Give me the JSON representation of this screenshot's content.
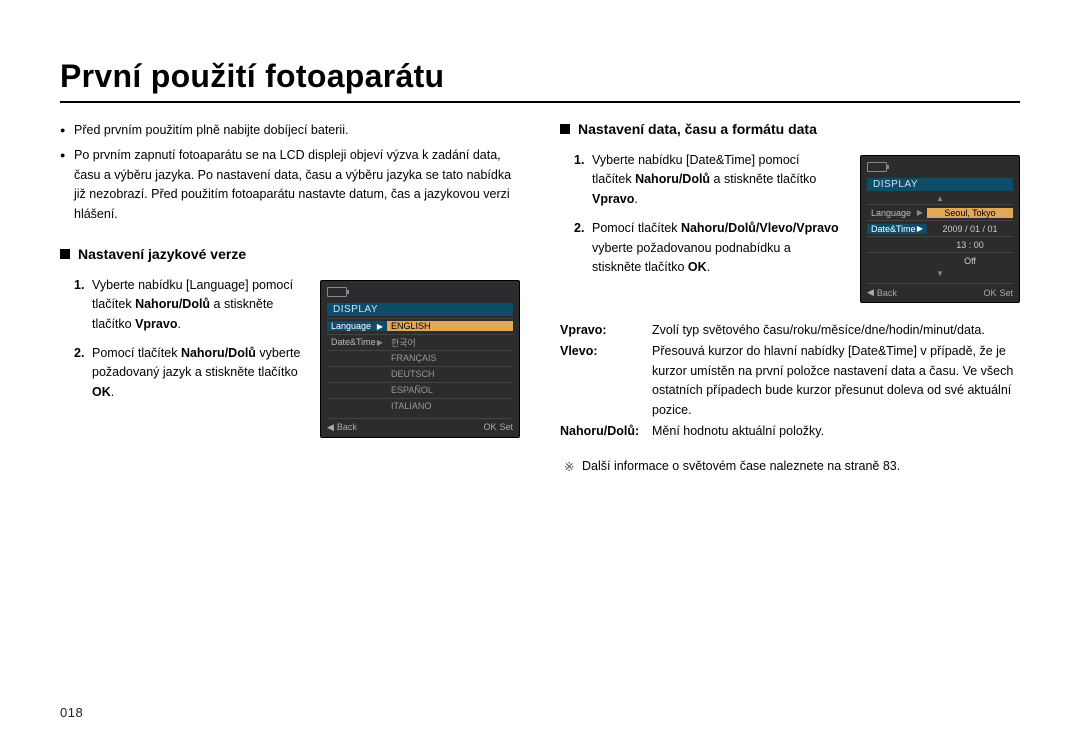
{
  "title": "První použití fotoaparátu",
  "pageNumber": "018",
  "intro": {
    "b1": "Před prvním použitím plně nabijte dobíjecí baterii.",
    "b2": "Po prvním zapnutí fotoaparátu se na LCD displeji objeví výzva k zadání data, času a výběru jazyka. Po nastavení data, času a výběru jazyka se tato nabídka již nezobrazí. Před použitím fotoaparátu nastavte datum, čas a jazykovou verzi hlášení."
  },
  "left": {
    "heading": "Nastavení jazykové verze",
    "s1a": "Vyberte nabídku [Language] pomocí tlačítek ",
    "s1b": "Nahoru/Dolů",
    "s1c": " a stiskněte tlačítko ",
    "s1d": "Vpravo",
    "s1e": ".",
    "s2a": "Pomocí tlačítek ",
    "s2b": "Nahoru/Dolů",
    "s2c": " vyberte požadovaný jazyk a stiskněte tlačítko ",
    "s2d": "OK",
    "s2e": "."
  },
  "right": {
    "heading": "Nastavení data, času a formátu data",
    "s1a": "Vyberte nabídku [Date&Time] pomocí tlačítek ",
    "s1b": "Nahoru/Dolů",
    "s1c": " a stiskněte tlačítko ",
    "s1d": "Vpravo",
    "s1e": ".",
    "s2a": "Pomocí tlačítek ",
    "s2b": "Nahoru/Dolů/Vlevo/Vpravo",
    "s2c": " vyberte požadovanou podnabídku a stiskněte tlačítko ",
    "s2d": "OK",
    "s2e": ".",
    "defs": {
      "k1": "Vpravo",
      "v1": "Zvolí typ světového času/roku/měsíce/dne/hodin/minut/data.",
      "k2": "Vlevo",
      "v2": "Přesouvá kurzor do hlavní nabídky [Date&Time] v případě, že je kurzor umístěn na první položce nastavení data a času. Ve všech ostatních případech bude kurzor přesunut doleva od své aktuální pozice.",
      "k3": "Nahoru/Dolů",
      "v3": "Mění hodnotu aktuální položky."
    },
    "note": "Další informace o světovém čase naleznete na straně 83."
  },
  "lcd1": {
    "header": "DISPLAY",
    "row1l": "Language",
    "row1r": "ENGLISH",
    "row2l": "Date&Time",
    "opts": {
      "o1": "한국어",
      "o2": "FRANÇAIS",
      "o3": "DEUTSCH",
      "o4": "ESPAÑOL",
      "o5": "ITALIANO"
    },
    "back": "Back",
    "ok": "OK",
    "set": "Set"
  },
  "lcd2": {
    "header": "DISPLAY",
    "row1l": "Language",
    "row2l": "Date&Time",
    "val1": "Seoul, Tokyo",
    "val2": "2009 / 01 / 01",
    "val3": "13 : 00",
    "val4": "Off",
    "back": "Back",
    "ok": "OK",
    "set": "Set"
  }
}
